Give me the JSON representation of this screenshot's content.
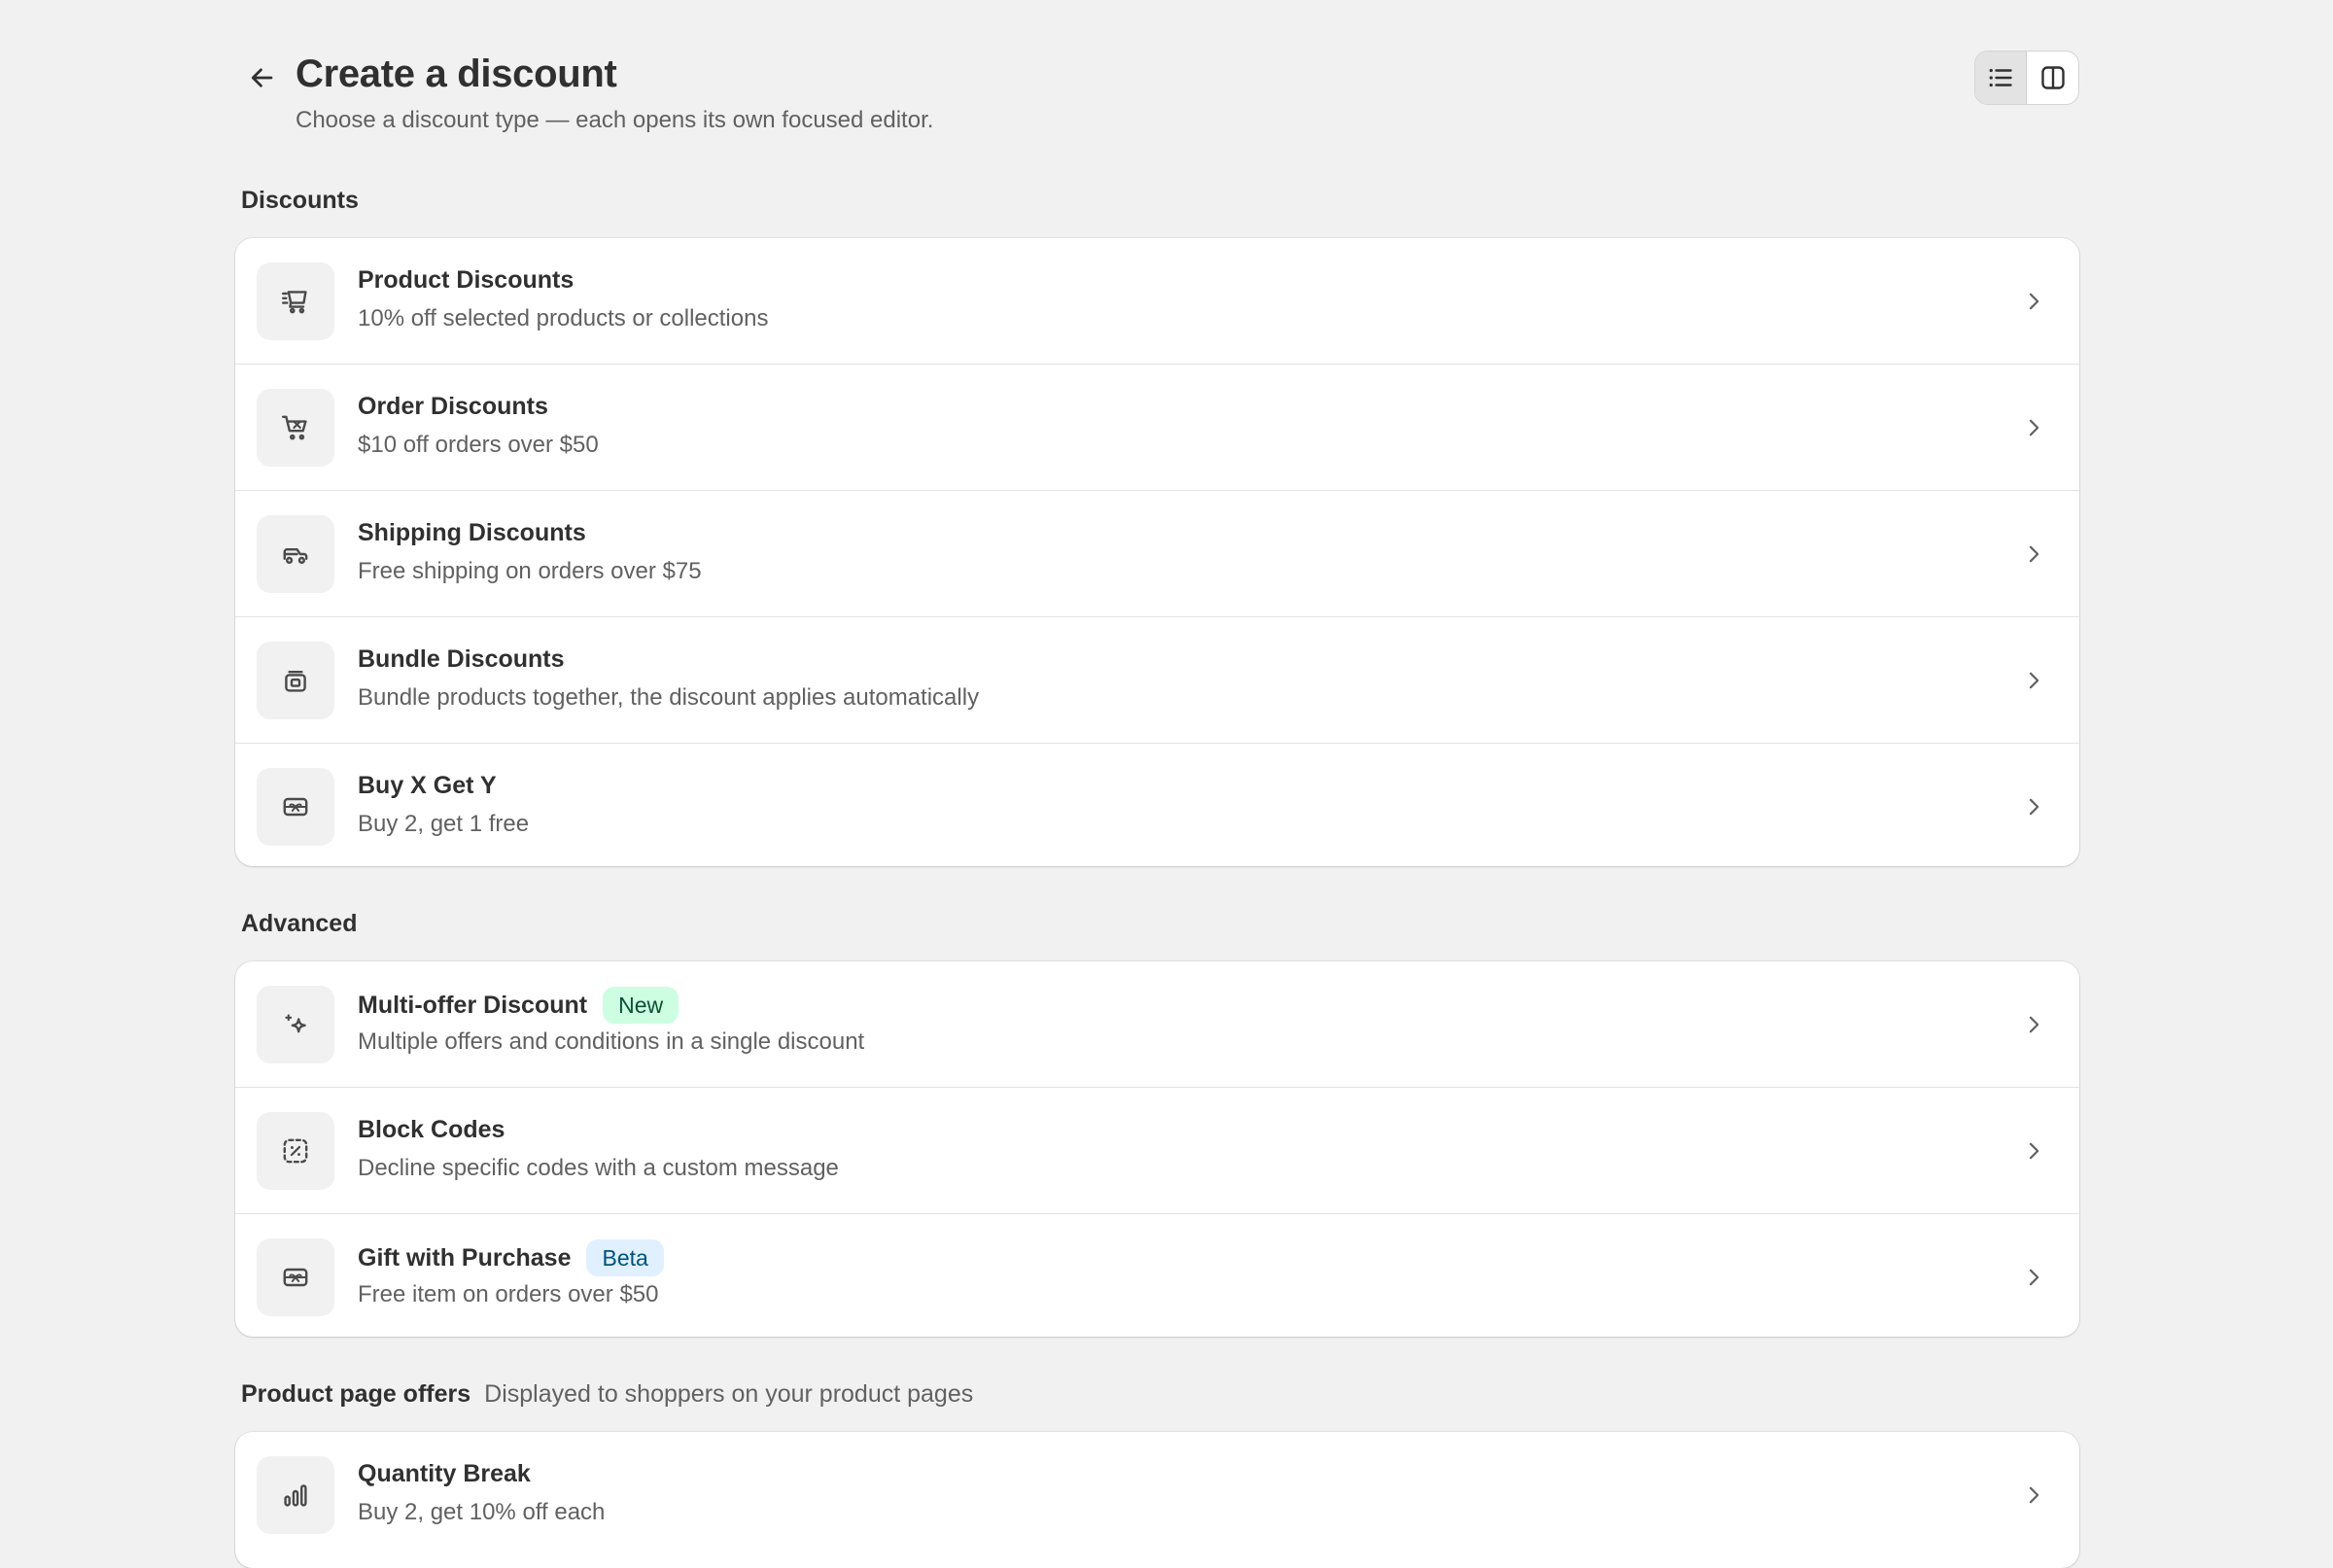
{
  "header": {
    "title": "Create a discount",
    "subtitle": "Choose a discount type — each opens its own focused editor."
  },
  "sections": {
    "discounts": {
      "heading": "Discounts",
      "items": [
        {
          "title": "Product Discounts",
          "desc": "10% off selected products or collections",
          "icon": "product-cart-icon"
        },
        {
          "title": "Order Discounts",
          "desc": "$10 off orders over $50",
          "icon": "order-cart-icon"
        },
        {
          "title": "Shipping Discounts",
          "desc": "Free shipping on orders over $75",
          "icon": "delivery-truck-icon"
        },
        {
          "title": "Bundle Discounts",
          "desc": "Bundle products together, the discount applies automatically",
          "icon": "bundle-box-icon"
        },
        {
          "title": "Buy X Get Y",
          "desc": "Buy 2, get 1 free",
          "icon": "gift-card-icon"
        }
      ]
    },
    "advanced": {
      "heading": "Advanced",
      "items": [
        {
          "title": "Multi-offer Discount",
          "badge": "New",
          "desc": "Multiple offers and conditions in a single discount",
          "icon": "sparkle-icon"
        },
        {
          "title": "Block Codes",
          "desc": "Decline specific codes with a custom message",
          "icon": "discount-code-dashed-icon"
        },
        {
          "title": "Gift with Purchase",
          "badge": "Beta",
          "desc": "Free item on orders over $50",
          "icon": "gift-card-icon"
        }
      ]
    },
    "product_page": {
      "heading": "Product page offers",
      "subheading": "Displayed to shoppers on your product pages",
      "items": [
        {
          "title": "Quantity Break",
          "desc": "Buy 2, get 10% off each",
          "icon": "bar-chart-icon"
        }
      ]
    }
  },
  "colors": {
    "background": "#f1f1f1",
    "card": "#ffffff",
    "badge_new_bg": "#cdfee1",
    "badge_beta_bg": "#e0f0ff"
  }
}
